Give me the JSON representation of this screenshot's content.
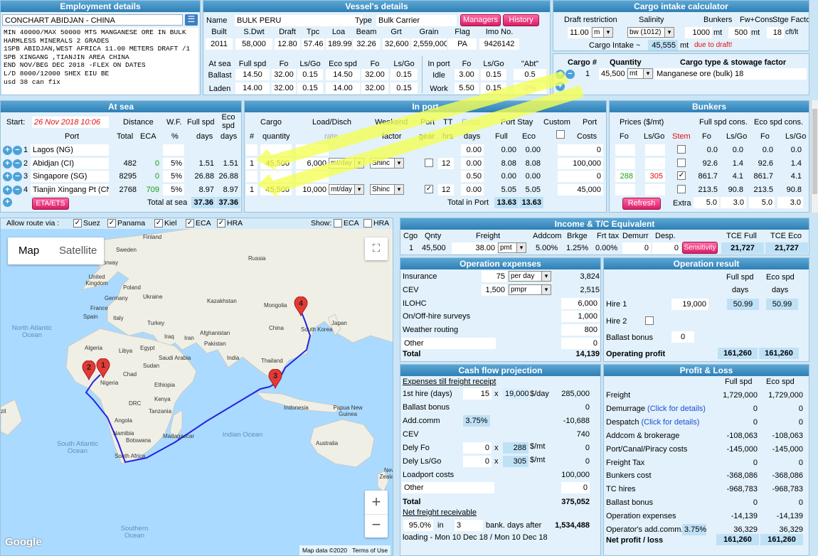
{
  "employment": {
    "title": "Employment details",
    "name": "CONCHART ABIDJAN - CHINA",
    "notes": [
      "MIN 40000/MAX 50000 MTS MANGANESE ORE IN BULK",
      "HARMLESS MINERALS 2 GRADES",
      "1SPB ABIDJAN,WEST AFRICA 11.00 METERS DRAFT /1",
      "SPB XINGANG ,TIANJIN AREA CHINA",
      "END NOV/BEG DEC 2018 -FLEX ON DATES",
      "L/D 8000/12000 SHEX EIU BE",
      "usd 38 can fix"
    ]
  },
  "vessel": {
    "title": "Vessel's details",
    "name_label": "Name",
    "name": "BULK PERU",
    "type_label": "Type",
    "type": "Bulk Carrier",
    "managers": "Managers",
    "history": "History",
    "headers": [
      "Built",
      "S.Dwt",
      "Draft",
      "Tpc",
      "Loa",
      "Beam",
      "Grt",
      "Grain",
      "Flag",
      "Imo No."
    ],
    "values": [
      "2011",
      "58,000",
      "12.80",
      "57.46",
      "189.99",
      "32.26",
      "32,600",
      "2,559,000",
      "PA",
      "9426142"
    ],
    "at_sea_hdr": [
      "At sea",
      "Full spd",
      "Fo",
      "Ls/Go",
      "Eco spd",
      "Fo",
      "Ls/Go"
    ],
    "ballast": [
      "Ballast",
      "14.50",
      "32.00",
      "0.15",
      "14.50",
      "32.00",
      "0.15"
    ],
    "laden": [
      "Laden",
      "14.00",
      "32.00",
      "0.15",
      "14.00",
      "32.00",
      "0.15"
    ],
    "in_port_hdr": [
      "In port",
      "Fo",
      "Ls/Go"
    ],
    "idle": [
      "Idle",
      "3.00",
      "0.15"
    ],
    "work": [
      "Work",
      "5.50",
      "0.15"
    ],
    "abt_hdr": "\"Abt\"",
    "abt_idle": "0.5",
    "abt_work": "0%"
  },
  "cargo_calc": {
    "title": "Cargo intake calculator",
    "hdr": [
      "Draft restriction",
      "Salinity",
      "Bunkers",
      "Fw+Cons.",
      "Stge Factor"
    ],
    "draft": "11.00",
    "draft_unit": "m",
    "salinity": "bw (1012)",
    "bunkers": "1000",
    "bunkers_unit": "mt",
    "fw": "500",
    "fw_unit": "mt",
    "stge": "18",
    "stge_unit": "cft/lt",
    "intake_label": "Cargo Intake ~",
    "intake": "45,555",
    "intake_unit": "mt",
    "intake_note": "due to draft!",
    "cargo_hdr": [
      "Cargo #",
      "Quantity",
      "Cargo type & stowage factor"
    ],
    "cargo_no": "1",
    "qty": "45,500",
    "qty_unit": "mt",
    "cargo_type": "Manganese ore (bulk) 18"
  },
  "at_sea": {
    "title": "At sea",
    "start_label": "Start:",
    "start": "26 Nov 2018 10:06",
    "hdr1": [
      "Distance",
      "W.F.",
      "Full spd",
      "Eco spd"
    ],
    "hdr2": [
      "Port",
      "Total",
      "ECA",
      "%",
      "days",
      "days"
    ],
    "ports": [
      {
        "no": "1",
        "name": "Lagos (NG)",
        "total": "",
        "eca": "",
        "wf": "",
        "full": "",
        "eco": ""
      },
      {
        "no": "2",
        "name": "Abidjan (CI)",
        "total": "482",
        "eca": "0",
        "wf": "5%",
        "full": "1.51",
        "eco": "1.51"
      },
      {
        "no": "3",
        "name": "Singapore (SG)",
        "total": "8295",
        "eca": "0",
        "wf": "5%",
        "full": "26.88",
        "eco": "26.88"
      },
      {
        "no": "4",
        "name": "Tianjin Xingang Pt (CN",
        "total": "2768",
        "eca": "709",
        "wf": "5%",
        "full": "8.97",
        "eco": "8.97"
      }
    ],
    "eta_btn": "ETA/ETS",
    "total_label": "Total at sea",
    "total_full": "37.36",
    "total_eco": "37.36"
  },
  "in_port": {
    "title": "In port",
    "hdr1": [
      "Cargo",
      "Load/Disch",
      "Weekend",
      "Port",
      "TT",
      "Extra",
      "Port Stay",
      "Custom",
      "Port"
    ],
    "hdr2": [
      "#",
      "quantity",
      "rate",
      "factor",
      "gear",
      "hrs",
      "days",
      "Full",
      "Eco",
      "Costs"
    ],
    "rows": [
      {
        "no": "",
        "qty": "",
        "rate": "",
        "unit": "",
        "wk": "",
        "tt": "",
        "extra": "0.00",
        "full": "0.00",
        "eco": "0.00",
        "cost": "0"
      },
      {
        "no": "1",
        "qty": "45,500",
        "rate": "6,000",
        "unit": "mt/day",
        "wk": "Shinc",
        "tt": "12",
        "extra": "0.00",
        "full": "8.08",
        "eco": "8.08",
        "cost": "100,000"
      },
      {
        "no": "",
        "qty": "",
        "rate": "",
        "unit": "",
        "wk": "",
        "tt": "",
        "extra": "0.50",
        "full": "0.00",
        "eco": "0.00",
        "cost": "0"
      },
      {
        "no": "1",
        "qty": "45,500",
        "rate": "10,000",
        "unit": "mt/day",
        "wk": "Shinc",
        "tt": "12",
        "extra": "0.00",
        "full": "5.05",
        "eco": "5.05",
        "cost": "45,000"
      }
    ],
    "total_label": "Total in Port",
    "total_full": "13.63",
    "total_eco": "13.63"
  },
  "bunkers": {
    "title": "Bunkers",
    "hdr1": [
      "Prices ($/mt)",
      "Full spd cons.",
      "Eco spd cons."
    ],
    "hdr2": [
      "Fo",
      "Ls/Go",
      "Stem",
      "Fo",
      "Ls/Go",
      "Fo",
      "Ls/Go"
    ],
    "rows": [
      {
        "fo": "",
        "ls": "",
        "full_fo": "0.0",
        "full_ls": "0.0",
        "eco_fo": "0.0",
        "eco_ls": "0.0"
      },
      {
        "fo": "",
        "ls": "",
        "full_fo": "92.6",
        "full_ls": "1.4",
        "eco_fo": "92.6",
        "eco_ls": "1.4"
      },
      {
        "fo": "288",
        "ls": "305",
        "full_fo": "861.7",
        "full_ls": "4.1",
        "eco_fo": "861.7",
        "eco_ls": "4.1"
      },
      {
        "fo": "",
        "ls": "",
        "full_fo": "213.5",
        "full_ls": "90.8",
        "eco_fo": "213.5",
        "eco_ls": "90.8"
      }
    ],
    "refresh": "Refresh",
    "extra_label": "Extra",
    "extra": [
      "5.0",
      "3.0",
      "5.0",
      "3.0"
    ]
  },
  "map": {
    "allow_label": "Allow route via :",
    "routes": [
      "Suez",
      "Panama",
      "Kiel",
      "ECA",
      "HRA"
    ],
    "show_label": "Show:",
    "show": [
      "ECA",
      "HRA"
    ],
    "tab_map": "Map",
    "tab_sat": "Satellite",
    "attribution": "Map data ©2020",
    "terms": "Terms of Use",
    "google": "Google",
    "labels": {
      "finland": "Finland",
      "sweden": "Sweden",
      "norway": "Norway",
      "russia": "Russia",
      "uk": "United Kingdom",
      "poland": "Poland",
      "germany": "Germany",
      "ukraine": "Ukraine",
      "france": "France",
      "kazakhstan": "Kazakhstan",
      "mongolia": "Mongolia",
      "spain": "Spain",
      "italy": "Italy",
      "turkey": "Turkey",
      "japan": "Japan",
      "north_atlantic": "North Atlantic Ocean",
      "iraq": "Iraq",
      "iran": "Iran",
      "afghanistan": "Afghanistan",
      "china": "China",
      "south_korea": "South Korea",
      "pakistan": "Pakistan",
      "algeria": "Algeria",
      "libya": "Libya",
      "egypt": "Egypt",
      "saudi": "Saudi Arabia",
      "india": "India",
      "thailand": "Thailand",
      "chad": "Chad",
      "sudan": "Sudan",
      "nigeria": "Nigeria",
      "ethiopia": "Ethiopia",
      "kenya": "Kenya",
      "drc": "DRC",
      "tanzania": "Tanzania",
      "indonesia": "Indonesia",
      "papua": "Papua New Guinea",
      "angola": "Angola",
      "namibia": "Namibia",
      "botswana": "Botswana",
      "madagascar": "Madagascar",
      "indian_ocean": "Indian Ocean",
      "australia": "Australia",
      "south_atlantic": "South Atlantic Ocean",
      "south_africa": "South Africa",
      "new_zealand": "New Zealand",
      "southern": "Southern Ocean",
      "brazil": "zil"
    },
    "markers": [
      "1",
      "2",
      "3",
      "4"
    ]
  },
  "income": {
    "title": "Income & T/C Equivalent",
    "hdr": [
      "Cgo",
      "Qnty",
      "Freight",
      "Addcom",
      "Brkge",
      "Frt tax",
      "Demurr",
      "Desp.",
      "TCE Full",
      "TCE Eco"
    ],
    "cgo": "1",
    "qnty": "45,500",
    "freight": "38.00",
    "freight_unit": "pmt",
    "addcom": "5.00%",
    "brkge": "1.25%",
    "frttax": "0.00%",
    "demurr": "0",
    "desp": "0",
    "sensitivity": "Sensitivity",
    "tce_full": "21,727",
    "tce_eco": "21,727"
  },
  "opex": {
    "title": "Operation expenses",
    "rows": [
      {
        "label": "Insurance",
        "input": "75",
        "unit": "per day",
        "value": "3,824"
      },
      {
        "label": "CEV",
        "input": "1,500",
        "unit": "pmpr",
        "value": "2,515"
      },
      {
        "label": "ILOHC",
        "input": "",
        "unit": "",
        "value": "6,000"
      },
      {
        "label": "On/Off-hire surveys",
        "input": "",
        "unit": "",
        "value": "1,000"
      },
      {
        "label": "Weather routing",
        "input": "",
        "unit": "",
        "value": "800"
      },
      {
        "label": "Other",
        "input": "",
        "unit": "",
        "value": "0"
      }
    ],
    "total_label": "Total",
    "total": "14,139"
  },
  "opresult": {
    "title": "Operation result",
    "hdr": [
      "Full spd",
      "Eco spd"
    ],
    "hdr2": [
      "days",
      "days"
    ],
    "hire1_label": "Hire 1",
    "hire1": "19,000",
    "hire1_full": "50.99",
    "hire1_eco": "50.99",
    "hire2_label": "Hire 2",
    "ballast_label": "Ballast bonus",
    "ballast": "0",
    "profit_label": "Operating profit",
    "profit_full": "161,260",
    "profit_eco": "161,260"
  },
  "cashflow": {
    "title": "Cash flow projection",
    "sub": "Expenses till freight receipt",
    "hire_label": "1st hire (days)",
    "hire_days": "15",
    "hire_x": "x",
    "hire_rate": "19,000",
    "hire_unit": "$/day",
    "hire_val": "285,000",
    "ballast_label": "Ballast bonus",
    "ballast_val": "0",
    "addcomm_label": "Add.comm",
    "addcomm_pct": "3.75%",
    "addcomm_val": "-10,688",
    "cev_label": "CEV",
    "cev_val": "740",
    "dfo_label": "Dely Fo",
    "dfo_qty": "0",
    "dfo_price": "288",
    "dfo_unit": "$/mt",
    "dfo_val": "0",
    "dls_label": "Dely Ls/Go",
    "dls_qty": "0",
    "dls_price": "305",
    "dls_unit": "$/mt",
    "dls_val": "0",
    "lp_label": "Loadport costs",
    "lp_val": "100,000",
    "other_label": "Other",
    "other_val": "0",
    "total_label": "Total",
    "total_val": "375,052",
    "net_label": "Net freight receivable",
    "net_pct": "95.0%",
    "net_in": "in",
    "net_days": "3",
    "net_after": "bank. days after",
    "net_val": "1,534,488",
    "loading": "loading - Mon 10 Dec 18 / Mon 10 Dec 18"
  },
  "pl": {
    "title": "Profit & Loss",
    "hdr": [
      "Full spd",
      "Eco spd"
    ],
    "rows": [
      {
        "label": "Freight",
        "full": "1,729,000",
        "eco": "1,729,000"
      },
      {
        "label": "Demurrage",
        "link": "(Click for details)",
        "full": "0",
        "eco": "0"
      },
      {
        "label": "Despatch",
        "link": "(Click for details)",
        "full": "0",
        "eco": "0"
      },
      {
        "label": "Addcom & brokerage",
        "full": "-108,063",
        "eco": "-108,063"
      },
      {
        "label": "Port/Canal/Piracy costs",
        "full": "-145,000",
        "eco": "-145,000"
      },
      {
        "label": "Freight Tax",
        "full": "0",
        "eco": "0"
      },
      {
        "label": "Bunkers cost",
        "full": "-368,086",
        "eco": "-368,086"
      },
      {
        "label": "TC hires",
        "full": "-968,783",
        "eco": "-968,783"
      },
      {
        "label": "Ballast bonus",
        "full": "0",
        "eco": "0"
      },
      {
        "label": "Operation expenses",
        "full": "-14,139",
        "eco": "-14,139"
      },
      {
        "label": "Operator's add.comm.",
        "pct": "3.75%",
        "full": "36,329",
        "eco": "36,329"
      }
    ],
    "net_label": "Net profit / loss",
    "net_full": "161,260",
    "net_eco": "161,260"
  }
}
